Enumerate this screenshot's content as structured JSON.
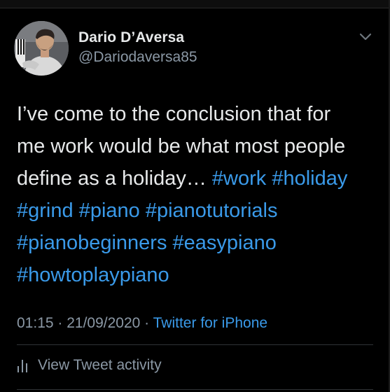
{
  "colors": {
    "background": "#000000",
    "text": "#e7e9ea",
    "secondary": "#8b98a5",
    "link": "#3a9ae9"
  },
  "author": {
    "name": "Dario D’Aversa",
    "handle": "@Dariodaversa85",
    "avatar_icon": "user-avatar"
  },
  "menu_icon": "chevron-down-icon",
  "tweet": {
    "line1": "I’ve come to the conclusion that for",
    "line2": "me work would be what most people",
    "line3_text": "define as a holiday… ",
    "hashtags": {
      "work": "#work",
      "holiday": "#holiday",
      "grind": "#grind",
      "piano": "#piano",
      "pianotutorials": "#pianotutorials",
      "pianobeginners": "#pianobeginners",
      "easypiano": "#easypiano",
      "howtoplaypiano": "#howtoplaypiano"
    }
  },
  "meta": {
    "time": "01:15",
    "separator1": " · ",
    "date": "21/09/2020",
    "separator2": " · ",
    "source": "Twitter for iPhone"
  },
  "activity": {
    "icon": "bar-chart-icon",
    "label": "View Tweet activity"
  }
}
